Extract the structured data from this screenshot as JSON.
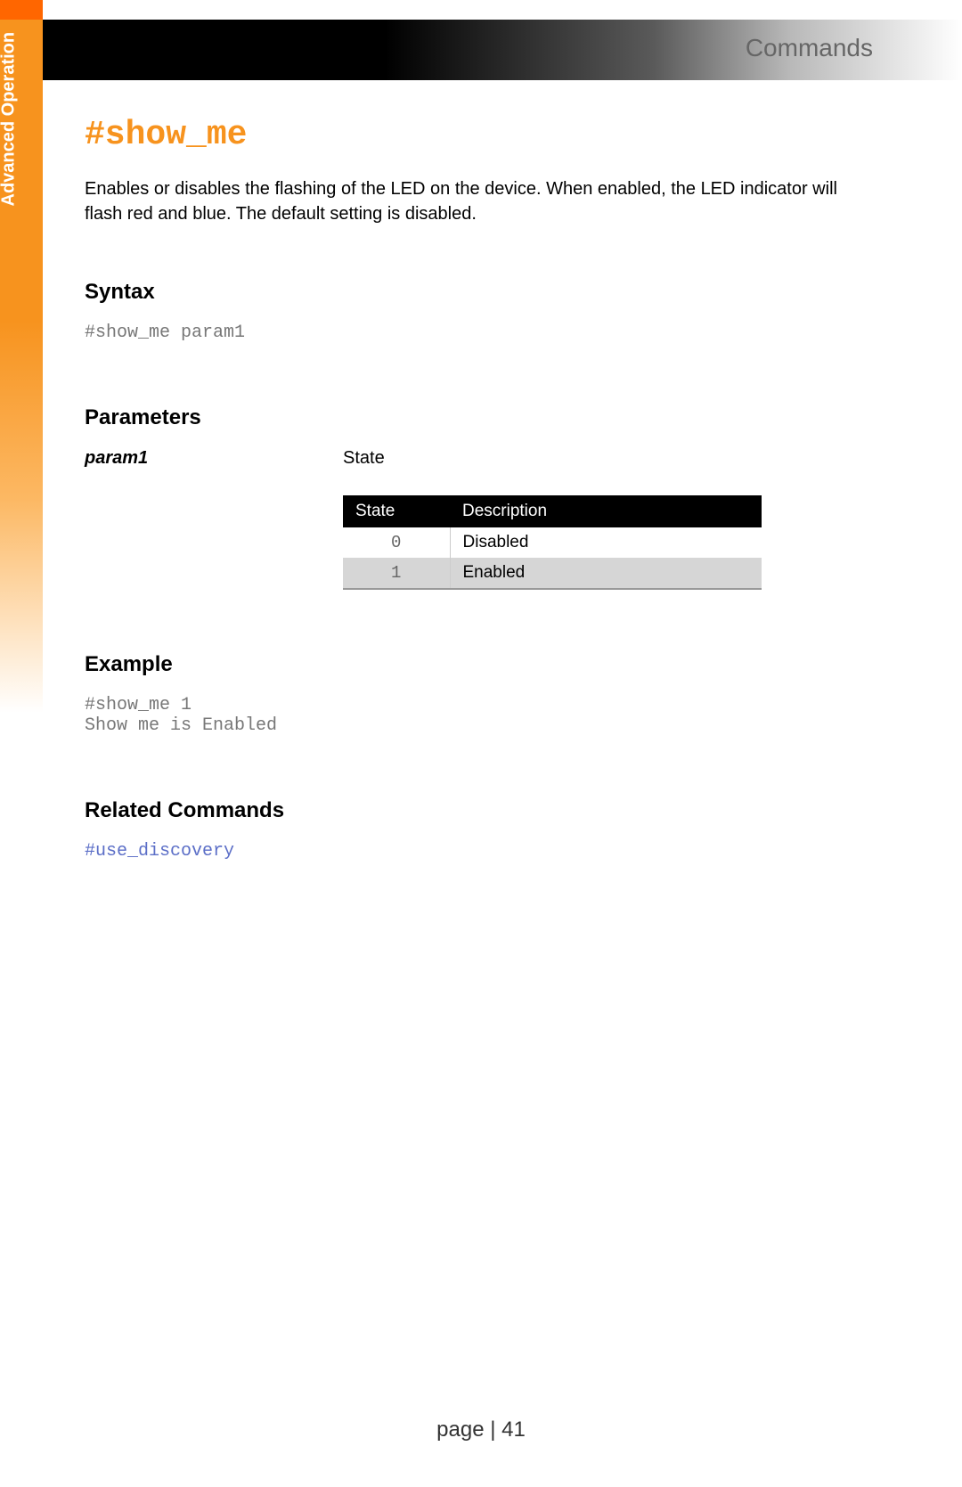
{
  "header": {
    "breadcrumb": "Commands"
  },
  "sidebar": {
    "section": "Advanced Operation"
  },
  "command": {
    "title": "#show_me",
    "description": "Enables or disables the flashing of the LED on the device. When enabled, the LED indicator will flash red and blue. The default setting is disabled."
  },
  "syntax": {
    "heading": "Syntax",
    "code": "#show_me param1"
  },
  "parameters": {
    "heading": "Parameters",
    "param_name": "param1",
    "param_label": "State",
    "table": {
      "headers": [
        "State",
        "Description"
      ],
      "rows": [
        {
          "state": "0",
          "desc": "Disabled"
        },
        {
          "state": "1",
          "desc": "Enabled"
        }
      ]
    }
  },
  "example": {
    "heading": "Example",
    "code": "#show_me 1\nShow me is Enabled"
  },
  "related": {
    "heading": "Related Commands",
    "link": "#use_discovery"
  },
  "footer": {
    "text": "page | 41"
  }
}
